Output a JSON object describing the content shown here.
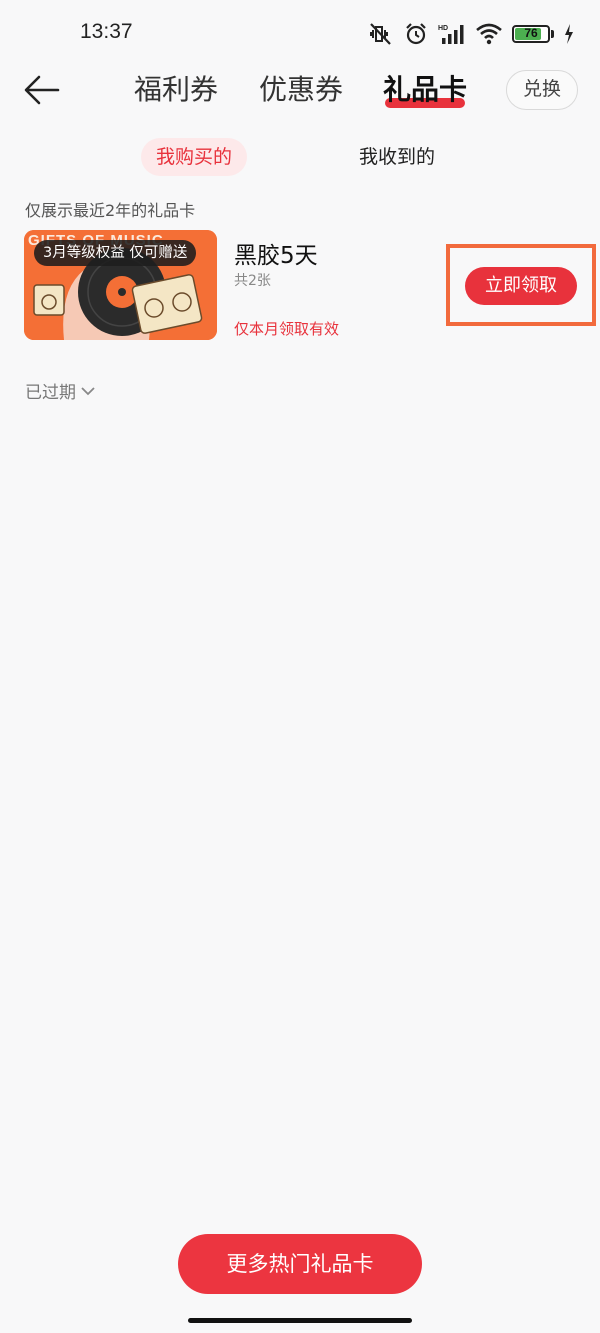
{
  "status_bar": {
    "time": "13:37",
    "battery_level": "76",
    "icons": [
      "mute-vibrate-icon",
      "alarm-icon",
      "hd-signal-icon",
      "wifi-icon",
      "battery-icon",
      "charging-bolt-icon"
    ]
  },
  "nav": {
    "back_icon": "back-arrow-icon",
    "tabs": [
      {
        "label": "福利券"
      },
      {
        "label": "优惠券"
      },
      {
        "label": "礼品卡"
      }
    ],
    "active_tab": "礼品卡",
    "exchange_label": "兑换"
  },
  "sub_tabs": {
    "purchased": "我购买的",
    "received": "我收到的",
    "active": "我购买的"
  },
  "notice": "仅展示最近2年的礼品卡",
  "card": {
    "image_caption": "GIFTS OF MUSIC",
    "badge": "3月等级权益 仅可赠送",
    "title": "黑胶5天",
    "count": "共2张",
    "validity": "仅本月领取有效",
    "claim_label": "立即领取"
  },
  "expired": {
    "label": "已过期",
    "icon": "chevron-down-icon"
  },
  "more_button": "更多热门礼品卡",
  "colors": {
    "accent": "#e8323c",
    "highlight_box": "#f26a3d",
    "background": "#f8f8f9"
  }
}
